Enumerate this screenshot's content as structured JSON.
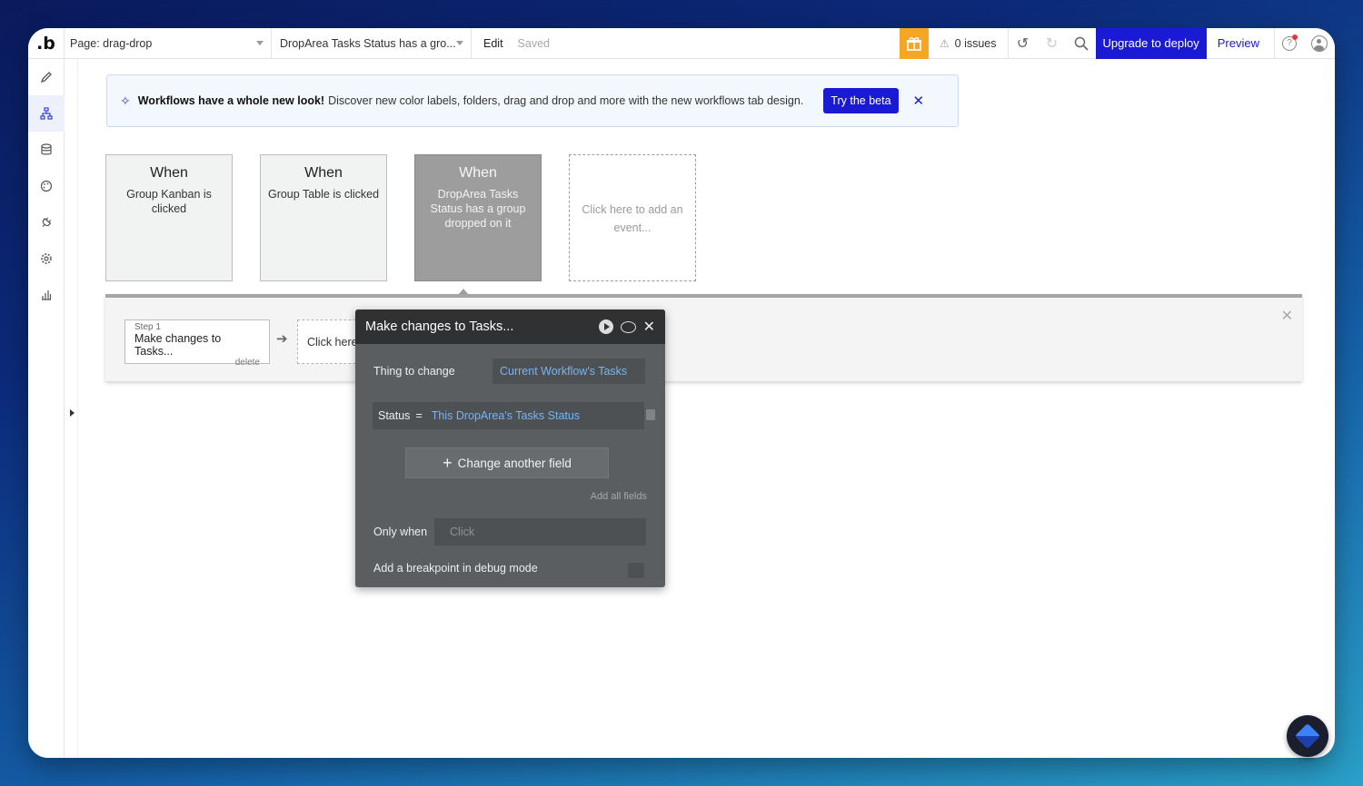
{
  "topbar": {
    "logo": ".b",
    "page_label": "Page: drag-drop",
    "workflow_label": "DropArea Tasks Status has a gro...",
    "edit_label": "Edit",
    "saved_label": "Saved",
    "issues_label": "0 issues",
    "upgrade_label": "Upgrade to deploy",
    "preview_label": "Preview",
    "icons": [
      "gift-icon",
      "warning-icon",
      "undo-icon",
      "redo-icon",
      "search-icon",
      "help-icon",
      "avatar-icon"
    ]
  },
  "sidebar": {
    "items": [
      {
        "name": "design",
        "icon": "pencil-icon"
      },
      {
        "name": "workflow",
        "icon": "workflow-icon",
        "active": true
      },
      {
        "name": "data",
        "icon": "database-icon"
      },
      {
        "name": "styles",
        "icon": "palette-icon"
      },
      {
        "name": "plugins",
        "icon": "plug-icon"
      },
      {
        "name": "settings",
        "icon": "gear-icon"
      },
      {
        "name": "logs",
        "icon": "chart-icon"
      }
    ]
  },
  "banner": {
    "bold": "Workflows have a whole new look!",
    "text": "Discover new color labels, folders, drag and drop and more with the new workflows tab design.",
    "button": "Try the beta"
  },
  "events": [
    {
      "when": "When",
      "desc": "Group Kanban is clicked",
      "selected": false
    },
    {
      "when": "When",
      "desc": "Group Table is clicked",
      "selected": false
    },
    {
      "when": "When",
      "desc": "DropArea Tasks Status has a group dropped on it",
      "selected": true
    },
    {
      "desc": "Click here to add an event..."
    }
  ],
  "steps": {
    "step1_label": "Step 1",
    "step1_title": "Make changes to Tasks...",
    "step1_delete": "delete",
    "add_step": "Click here"
  },
  "editor": {
    "title": "Make changes to Tasks...",
    "thing_label": "Thing to change",
    "thing_value": "Current Workflow's Tasks",
    "status_label": "Status",
    "status_eq": "=",
    "status_value": "This DropArea's Tasks Status",
    "change_button": "Change another field",
    "add_all": "Add all fields",
    "only_when_label": "Only when",
    "only_when_placeholder": "Click",
    "debug_label": "Add a breakpoint in debug mode"
  },
  "colors": {
    "accent": "#1a1ad4",
    "gift": "#f5a623",
    "editor_bg": "#5a5e61",
    "editor_head": "#2f3133",
    "link_blue": "#7ab3ee"
  }
}
